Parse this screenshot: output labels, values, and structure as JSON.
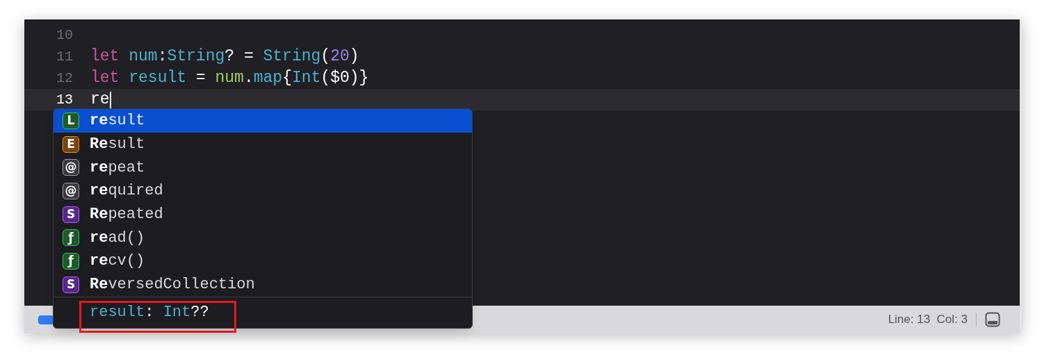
{
  "editor": {
    "lines": [
      {
        "number": "10",
        "current": false
      },
      {
        "number": "11",
        "current": false,
        "tokens": [
          {
            "text": "let ",
            "kind": "keyword"
          },
          {
            "text": "num",
            "kind": "decl"
          },
          {
            "text": ":",
            "kind": "plain"
          },
          {
            "text": "String",
            "kind": "type"
          },
          {
            "text": "? = ",
            "kind": "plain"
          },
          {
            "text": "String",
            "kind": "type"
          },
          {
            "text": "(",
            "kind": "plain"
          },
          {
            "text": "20",
            "kind": "number"
          },
          {
            "text": ")",
            "kind": "plain"
          }
        ]
      },
      {
        "number": "12",
        "current": false,
        "tokens": [
          {
            "text": "let ",
            "kind": "keyword"
          },
          {
            "text": "result",
            "kind": "decl"
          },
          {
            "text": " = ",
            "kind": "plain"
          },
          {
            "text": "num",
            "kind": "local"
          },
          {
            "text": ".",
            "kind": "plain"
          },
          {
            "text": "map",
            "kind": "type"
          },
          {
            "text": "{",
            "kind": "plain"
          },
          {
            "text": "Int",
            "kind": "type"
          },
          {
            "text": "($0)}",
            "kind": "plain"
          }
        ]
      },
      {
        "number": "13",
        "current": true,
        "tokens": [
          {
            "text": "re",
            "kind": "plain"
          }
        ]
      }
    ]
  },
  "completion": {
    "items": [
      {
        "badge": "L",
        "kind": "local",
        "match": "re",
        "rest": "sult",
        "selected": true
      },
      {
        "badge": "E",
        "kind": "enum",
        "match": "Re",
        "rest": "sult",
        "selected": false
      },
      {
        "badge": "@",
        "kind": "keyword",
        "match": "re",
        "rest": "peat",
        "selected": false
      },
      {
        "badge": "@",
        "kind": "keyword",
        "match": "re",
        "rest": "quired",
        "selected": false
      },
      {
        "badge": "S",
        "kind": "struct",
        "match": "Re",
        "rest": "peated",
        "selected": false
      },
      {
        "badge": "ƒ",
        "kind": "function",
        "match": "re",
        "rest": "ad()",
        "selected": false
      },
      {
        "badge": "ƒ",
        "kind": "function",
        "match": "re",
        "rest": "cv()",
        "selected": false
      },
      {
        "badge": "S",
        "kind": "struct",
        "match": "Re",
        "rest": "versedCollection",
        "selected": false
      }
    ],
    "detail": [
      {
        "text": "result",
        "kind": "type"
      },
      {
        "text": ": ",
        "kind": "plain"
      },
      {
        "text": "Int",
        "kind": "type"
      },
      {
        "text": "??",
        "kind": "plain"
      }
    ]
  },
  "status_bar": {
    "position": "Line: 13  Col: 3"
  }
}
